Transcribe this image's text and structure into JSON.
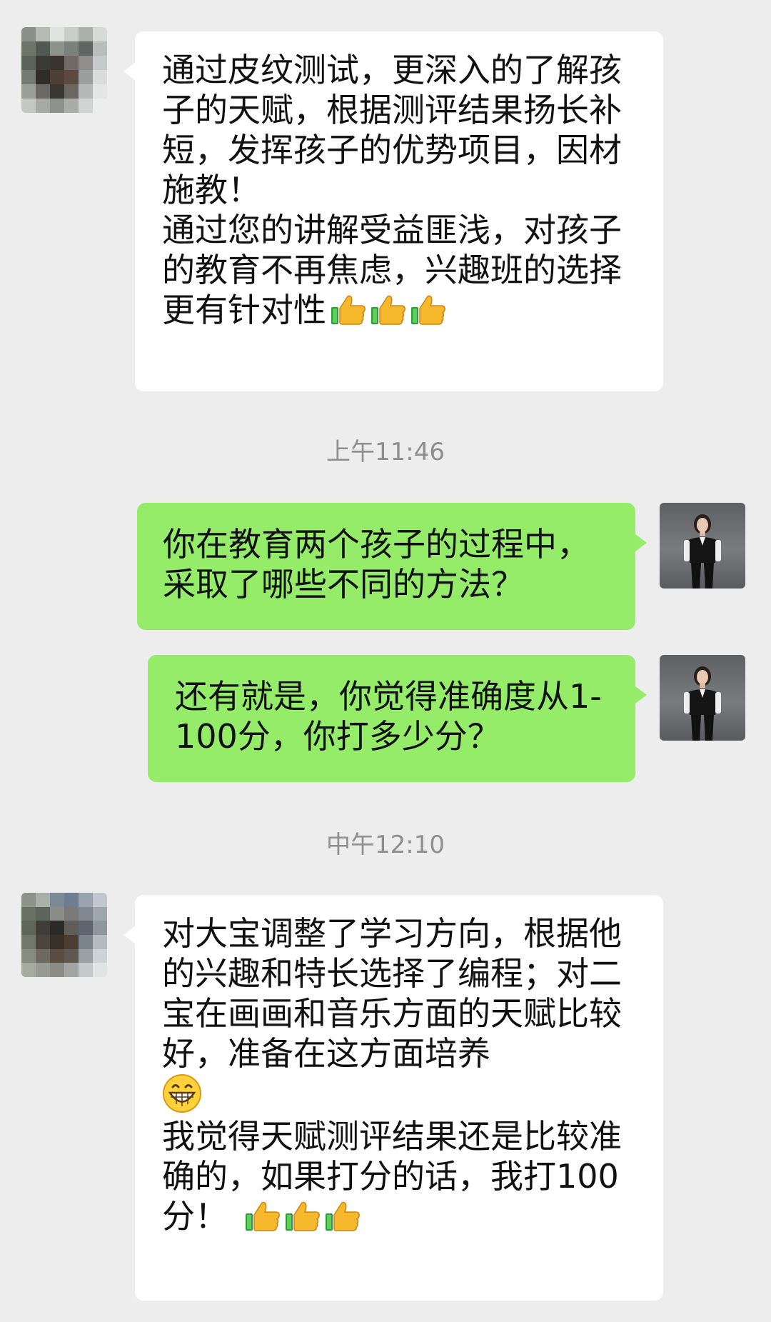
{
  "messages": [
    {
      "side": "left",
      "text": "通过皮纹测试，更深入的了解孩子的天赋，根据测评结果扬长补短，发挥孩子的优势项目，因材施教！\n通过您的讲解受益匪浅，对孩子的教育不再焦虑，兴趣班的选择更有针对性",
      "emojis": [
        "thumbs-up",
        "thumbs-up",
        "thumbs-up"
      ]
    },
    {
      "side": "right",
      "text": "你在教育两个孩子的过程中，采取了哪些不同的方法？"
    },
    {
      "side": "right",
      "text": "还有就是，你觉得准确度从1-100分，你打多少分？"
    },
    {
      "side": "left",
      "text_part1": "对大宝调整了学习方向，根据他的兴趣和特长选择了编程；对二宝在画画和音乐方面的天赋比较好，准备在这方面培养",
      "text_part2": "我觉得天赋测评结果还是比较准确的，如果打分的话，我打100分！",
      "emojis": [
        "grinning-face",
        "thumbs-up",
        "thumbs-up",
        "thumbs-up"
      ]
    }
  ],
  "timestamps": {
    "first": "上午11:46",
    "second": "中午12:10"
  },
  "colors": {
    "background": "#ededed",
    "incoming_bubble": "#ffffff",
    "outgoing_bubble": "#95ec69",
    "timestamp_text": "#8e8e8e"
  },
  "icons": [
    "pixelated-avatar-icon",
    "profile-photo-avatar-icon",
    "thumbs-up-emoji-icon",
    "grinning-face-emoji-icon"
  ]
}
